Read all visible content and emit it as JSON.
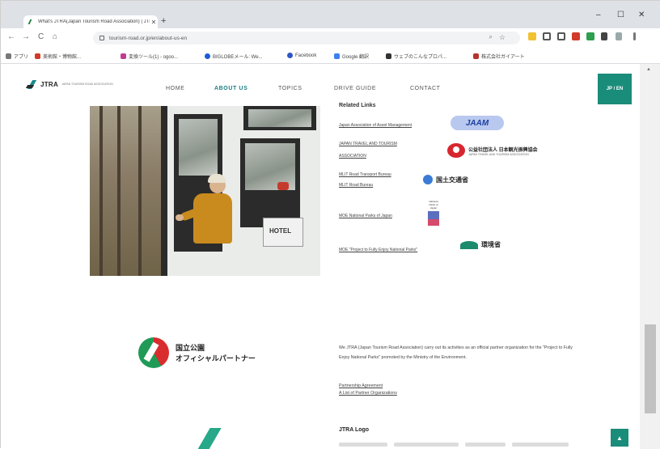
{
  "browser": {
    "tab_title": "What's JTRA(Japan Tourism Road Association) | JTRA",
    "new_tab_symbol": "+",
    "tab_close_symbol": "✕",
    "window": {
      "minimize": "–",
      "maximize": "☐",
      "close": "✕"
    },
    "url": "tourism-road.or.jp/en/about-us-en",
    "nav": {
      "back": "←",
      "forward": "→",
      "reload": "C",
      "home": "⌂"
    },
    "bookmarks": [
      "アプリ",
      "美術館・博物館...",
      "変換ツール(1) - ogoo...",
      "BIGLOBEメール: We...",
      "Facebook",
      "Google 翻訳",
      "ウェブのこんなプロパ...",
      "株式会社ガイアート"
    ],
    "colors": {
      "accent": "#1a8c7a",
      "link": "#1a7f86"
    }
  },
  "site": {
    "logo_text": "JTRA",
    "logo_sub": "JAPAN TOURISM ROAD ASSOCIATION",
    "menu": [
      "HOME",
      "ABOUT US",
      "TOPICS",
      "DRIVE GUIDE",
      "CONTACT"
    ],
    "lang_toggle": "JP / EN"
  },
  "photo": {
    "sign_text": "HOTEL",
    "alt": ""
  },
  "related": {
    "title": "Related Links",
    "links": [
      "Japan Association of Asset Management",
      "JAPAN TRAVEL AND TOURISM",
      "ASSOCIATION",
      "MLIT Road Transport Bureau",
      "MLIT Road Bureau",
      "MOE National Parks of Japan",
      "MOE \"Project to Fully Enjoy National Parks\""
    ],
    "jaam_badge": "JAAM",
    "jttaa_jp": "公益社団法人 日本観光振興協会",
    "jttaa_en": "JAPAN TRAVEL AND TOURISM ASSOCIATION",
    "mlit_text": "国土交通省",
    "moe_np_caption": "National Parks of Japan",
    "moe_text": "環境省"
  },
  "partner": {
    "jp_line1": "国立公園",
    "jp_line2": "オフィシャルパートナー",
    "desc": "We JTRA (Japan Tourism Road Association) carry out its activities as an official partner organization for the \"Project to Fully Enjoy National Parks\" promoted by the Ministry of the Environment.",
    "links": [
      "Partnership Agreement",
      "A List of Partner Organizations"
    ]
  },
  "logo_section": {
    "title": "JTRA Logo"
  },
  "to_top": "▲"
}
